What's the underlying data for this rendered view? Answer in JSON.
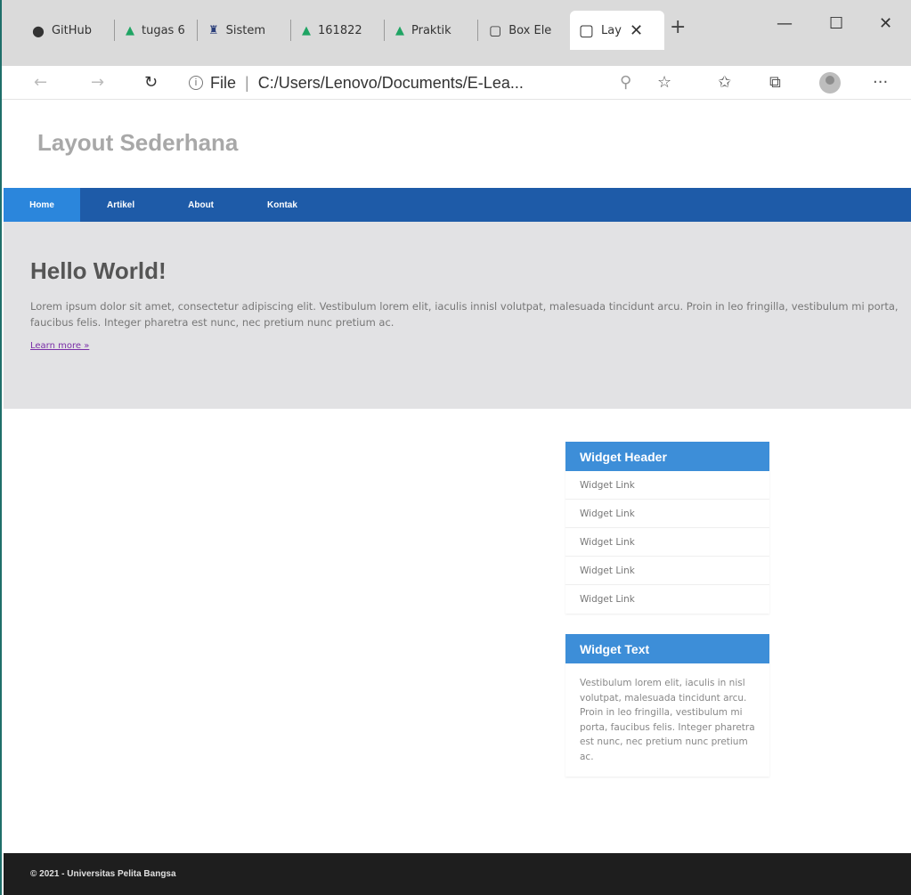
{
  "browser": {
    "tabs": [
      {
        "label": "GitHub",
        "icon": "github-icon"
      },
      {
        "label": "tugas 6",
        "icon": "google-drive-icon"
      },
      {
        "label": "Sistem",
        "icon": "university-icon"
      },
      {
        "label": "161822",
        "icon": "google-drive-icon"
      },
      {
        "label": "Praktik",
        "icon": "google-drive-icon"
      },
      {
        "label": "Box Ele",
        "icon": "document-icon"
      },
      {
        "label": "Lay",
        "icon": "document-icon"
      }
    ],
    "new_tab": "+",
    "window": {
      "minimize": "—",
      "maximize": "☐",
      "close": "✕"
    },
    "address": {
      "prefix": "File",
      "url": "C:/Users/Lenovo/Documents/E-Lea..."
    }
  },
  "site": {
    "title": "Layout Sederhana",
    "nav": [
      "Home",
      "Artikel",
      "About",
      "Kontak"
    ],
    "hero": {
      "heading": "Hello World!",
      "text": "Lorem ipsum dolor sit amet, consectetur adipiscing elit. Vestibulum lorem elit, iaculis innisl volutpat, malesuada tincidunt arcu. Proin in leo fringilla, vestibulum mi porta, faucibus felis. Integer pharetra est nunc, nec pretium nunc pretium ac.",
      "link": "Learn more »"
    },
    "widget_links": {
      "header": "Widget Header",
      "items": [
        "Widget Link",
        "Widget Link",
        "Widget Link",
        "Widget Link",
        "Widget Link"
      ]
    },
    "widget_text": {
      "header": "Widget Text",
      "body": "Vestibulum lorem elit, iaculis in nisl volutpat, malesuada tincidunt arcu. Proin in leo fringilla, vestibulum mi porta, faucibus felis. Integer pharetra est nunc, nec pretium nunc pretium ac."
    },
    "footer": "© 2021 - Universitas Pelita Bangsa"
  },
  "colors": {
    "nav": "#1e5ba8",
    "nav_active": "#2b86dc",
    "widget_header": "#3d8ed8",
    "hero_bg": "#e2e2e4",
    "footer_bg": "#1e1e1e"
  }
}
